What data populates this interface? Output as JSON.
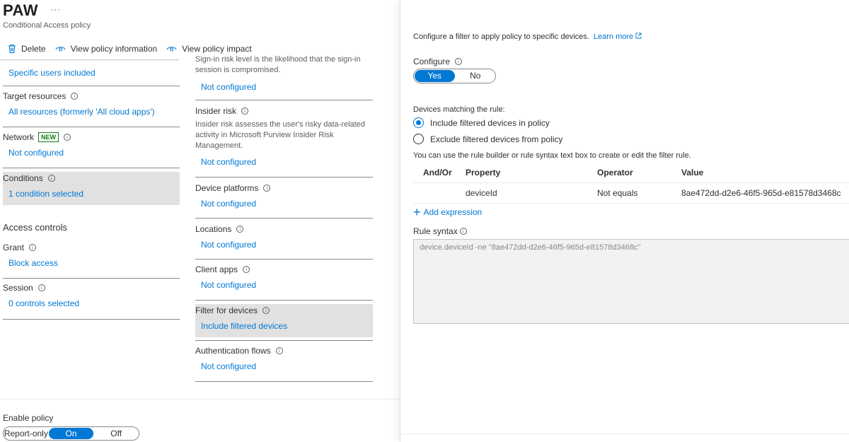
{
  "header": {
    "title": "PAW",
    "more": "···",
    "subtitle": "Conditional Access policy"
  },
  "toolbar": {
    "delete_label": "Delete",
    "view_info_label": "View policy information",
    "view_impact_label": "View policy impact"
  },
  "assignments": {
    "users_value": "Specific users included",
    "target_label": "Target resources",
    "target_value": "All resources (formerly 'All cloud apps')",
    "network_label": "Network",
    "network_badge": "NEW",
    "network_value": "Not configured",
    "conditions_label": "Conditions",
    "conditions_value": "1 condition selected"
  },
  "access_controls": {
    "heading": "Access controls",
    "grant_label": "Grant",
    "grant_value": "Block access",
    "session_label": "Session",
    "session_value": "0 controls selected"
  },
  "conditions": {
    "signin_risk_desc": "Sign-in risk level is the likelihood that the sign-in session is compromised.",
    "signin_risk_value": "Not configured",
    "insider_label": "Insider risk",
    "insider_desc": "Insider risk assesses the user's risky data-related activity in Microsoft Purview Insider Risk Management.",
    "insider_value": "Not configured",
    "platforms_label": "Device platforms",
    "platforms_value": "Not configured",
    "locations_label": "Locations",
    "locations_value": "Not configured",
    "client_apps_label": "Client apps",
    "client_apps_value": "Not configured",
    "filter_label": "Filter for devices",
    "filter_value": "Include filtered devices",
    "auth_flows_label": "Authentication flows",
    "auth_flows_value": "Not configured"
  },
  "enable_policy": {
    "label": "Enable policy",
    "options": [
      "Report-only",
      "On",
      "Off"
    ],
    "selected": "On"
  },
  "filter_panel": {
    "description": "Configure a filter to apply policy to specific devices.",
    "learn_more": "Learn more",
    "configure_label": "Configure",
    "configure_yes": "Yes",
    "configure_no": "No",
    "configure_selected": "Yes",
    "matching_label": "Devices matching the rule:",
    "include_option": "Include filtered devices in policy",
    "exclude_option": "Exclude filtered devices from policy",
    "selected_option": "include",
    "hint": "You can use the rule builder or rule syntax text box to create or edit the filter rule.",
    "columns": [
      "And/Or",
      "Property",
      "Operator",
      "Value"
    ],
    "rows": [
      {
        "andor": "",
        "property": "deviceId",
        "operator": "Not equals",
        "value": "8ae472dd-d2e6-46f5-965d-e81578d3468c"
      }
    ],
    "add_expression": "Add expression",
    "rule_syntax_label": "Rule syntax",
    "rule_syntax": "device.deviceId -ne \"8ae472dd-d2e6-46f5-965d-e81578d3468c\""
  },
  "colors": {
    "accent": "#0078d4",
    "selected_bg": "#e1e1e1",
    "badge_green": "#107c10"
  }
}
